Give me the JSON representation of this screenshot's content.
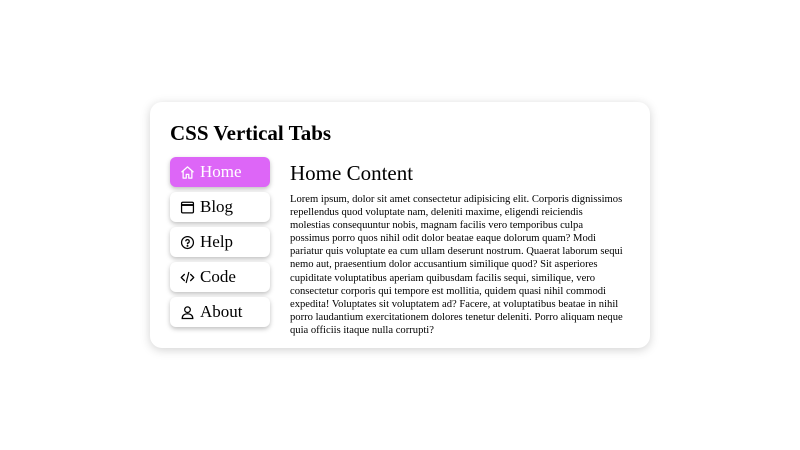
{
  "card": {
    "title": "CSS Vertical Tabs"
  },
  "tabs": [
    {
      "label": "Home",
      "icon": "home-icon",
      "active": true
    },
    {
      "label": "Blog",
      "icon": "window-icon",
      "active": false
    },
    {
      "label": "Help",
      "icon": "help-circle-icon",
      "active": false
    },
    {
      "label": "Code",
      "icon": "code-icon",
      "active": false
    },
    {
      "label": "About",
      "icon": "user-icon",
      "active": false
    }
  ],
  "content": {
    "title": "Home Content",
    "body": "Lorem ipsum, dolor sit amet consectetur adipisicing elit. Corporis dignissimos repellendus quod voluptate nam, deleniti maxime, eligendi reiciendis molestias consequuntur nobis, magnam facilis vero temporibus culpa possimus porro quos nihil odit dolor beatae eaque dolorum quam? Modi pariatur quis voluptate ea cum ullam deserunt nostrum. Quaerat laborum sequi nemo aut, praesentium dolor accusantium similique quod? Sit asperiores cupiditate voluptatibus aperiam quibusdam facilis sequi, similique, vero consectetur corporis qui tempore est mollitia, quidem quasi nihil commodi expedita! Voluptates sit voluptatem ad? Facere, at voluptatibus beatae in nihil porro laudantium exercitationem dolores tenetur deleniti. Porro aliquam neque quia officiis itaque nulla corrupti?"
  },
  "colors": {
    "active_tab_bg": "#dd66f7",
    "active_tab_text": "#ffffff",
    "background": "#ffffff"
  }
}
